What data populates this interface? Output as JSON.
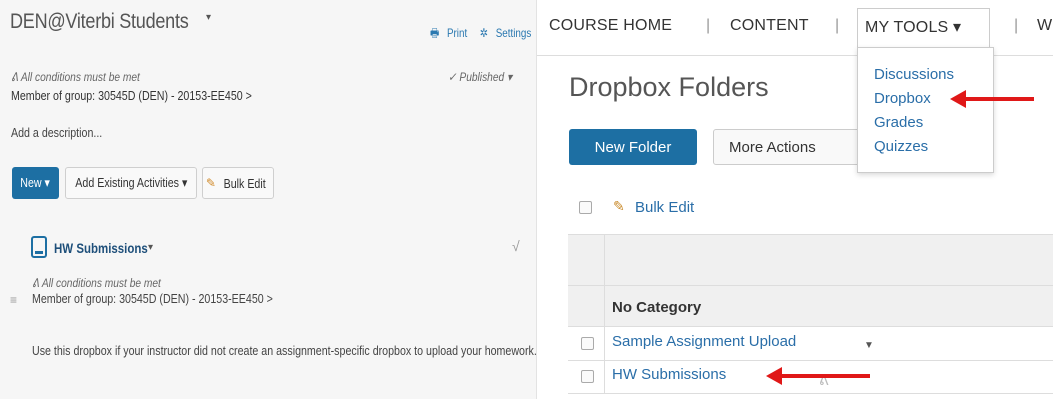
{
  "left": {
    "title": "DEN@Viterbi Students",
    "title_caret": "▾",
    "print_label": "Print",
    "settings_label": "Settings",
    "conditions_text": "All conditions must be met",
    "published_label": "Published",
    "member_text": "Member of group: 30545D (DEN) - 20153-EE450 >",
    "add_description": "Add a description...",
    "new_button": "New ▾",
    "add_existing_button": "Add Existing Activities ▾",
    "bulk_edit_button": "Bulk Edit",
    "item": {
      "title": "HW Submissions",
      "caret": "▾",
      "check": "√",
      "conditions_text": "All conditions must be met",
      "member_text": "Member of group: 30545D (DEN) - 20153-EE450 >",
      "description": "Use this dropbox if your instructor did not create an assignment-specific dropbox to upload your homework."
    }
  },
  "right": {
    "nav": {
      "course_home": "COURSE HOME",
      "content": "CONTENT",
      "my_tools": "MY TOOLS ▾",
      "sep": "|",
      "next_partial": "W"
    },
    "dropdown": [
      "Discussions",
      "Dropbox",
      "Grades",
      "Quizzes"
    ],
    "title": "Dropbox Folders",
    "new_folder_button": "New Folder",
    "more_actions_button": "More Actions",
    "bulk_edit": "Bulk Edit",
    "table": {
      "category": "No Category",
      "rows": [
        "Sample Assignment Upload",
        "HW Submissions"
      ]
    }
  },
  "colors": {
    "primary": "#1d6fa3",
    "link": "#2a6ea8",
    "annotation_arrow": "#e01818"
  },
  "icons": [
    "print-icon",
    "settings-gear-icon",
    "conditions-icon",
    "check-icon",
    "pencil-icon",
    "dropbox-device-icon",
    "drag-handle-icon",
    "caret-down-icon",
    "red-arrow-annotation"
  ]
}
